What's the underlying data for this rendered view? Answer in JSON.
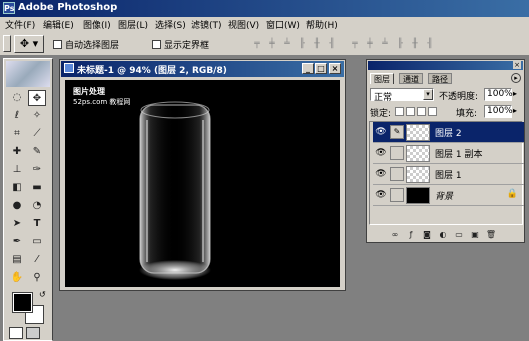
{
  "app": {
    "title": "Adobe Photoshop",
    "icon_name": "photoshop-icon"
  },
  "menu": [
    "文件(F)",
    "编辑(E)",
    "图像(I)",
    "图层(L)",
    "选择(S)",
    "滤镜(T)",
    "视图(V)",
    "窗口(W)",
    "帮助(H)"
  ],
  "options": {
    "auto_select_label": "自动选择图层",
    "show_bbox_label": "显示定界框"
  },
  "document": {
    "title": "未标题-1 @ 94% (图层 2, RGB/8)",
    "watermark_line1": "图片处理",
    "watermark_line2": "52ps.com  教程网"
  },
  "layers_panel": {
    "tabs": [
      "图层",
      "通道",
      "路径"
    ],
    "blend_mode": "正常",
    "opacity_label": "不透明度:",
    "opacity_value": "100%",
    "lock_label": "锁定:",
    "fill_label": "填充:",
    "fill_value": "100%",
    "layers": [
      {
        "name": "图层 2",
        "selected": true,
        "type": "transparent"
      },
      {
        "name": "图层 1 副本",
        "selected": false,
        "type": "transparent"
      },
      {
        "name": "图层 1",
        "selected": false,
        "type": "transparent"
      },
      {
        "name": "背景",
        "selected": false,
        "type": "black",
        "locked": true
      }
    ]
  },
  "colors": {
    "titlebar": "#0a246a",
    "selection": "#0a246a",
    "panel": "#d4d0c8",
    "workspace": "#808080"
  }
}
